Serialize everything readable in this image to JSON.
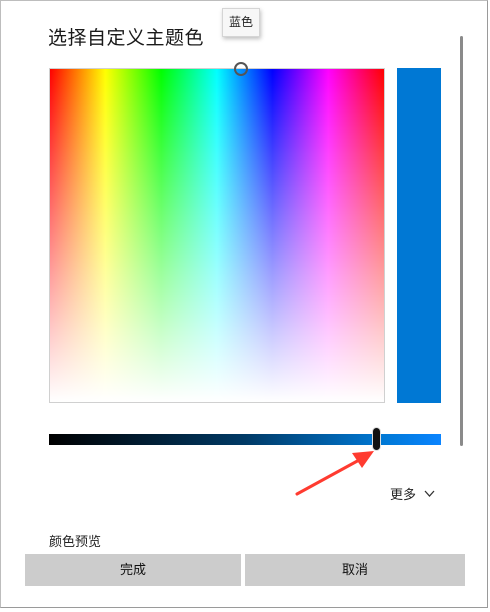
{
  "dialog": {
    "title": "选择自定义主题色",
    "tooltip": "蓝色",
    "more_label": "更多",
    "preview_label": "颜色预览",
    "done_label": "完成",
    "cancel_label": "取消"
  },
  "colors": {
    "selected": "#0078d4",
    "arrow": "#ff3b30"
  },
  "icons": {
    "more_toggle": "chevron-down-icon"
  }
}
